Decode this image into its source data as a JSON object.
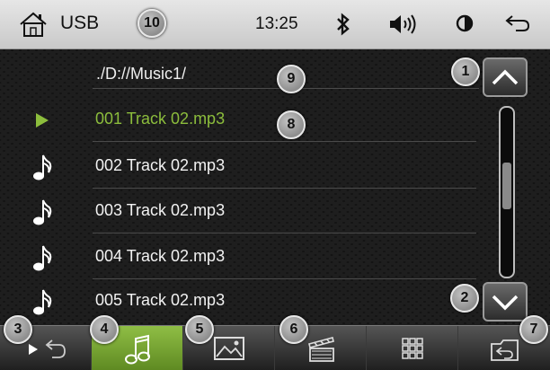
{
  "statusbar": {
    "source": "USB",
    "time": "13:25",
    "icons": [
      "home-icon",
      "bluetooth-icon",
      "volume-icon",
      "brightness-icon",
      "back-icon"
    ]
  },
  "browser": {
    "path": "./D://Music1/",
    "tracks": [
      {
        "name": "001 Track 02.mp3",
        "icon": "play-icon",
        "active": true
      },
      {
        "name": "002 Track 02.mp3",
        "icon": "music-note-icon",
        "active": false
      },
      {
        "name": "003 Track 02.mp3",
        "icon": "music-note-icon",
        "active": false
      },
      {
        "name": "004 Track 02.mp3",
        "icon": "music-note-icon",
        "active": false
      },
      {
        "name": "005 Track 02.mp3",
        "icon": "music-note-icon",
        "active": false
      }
    ],
    "scroll_position": 0.45
  },
  "toolbar": {
    "buttons": [
      {
        "name": "play-return-button",
        "icon": "play-return-icon",
        "active": false
      },
      {
        "name": "music-button",
        "icon": "music-note-icon",
        "active": true
      },
      {
        "name": "picture-button",
        "icon": "picture-icon",
        "active": false
      },
      {
        "name": "video-button",
        "icon": "clapperboard-icon",
        "active": false
      },
      {
        "name": "grid-button",
        "icon": "grid-icon",
        "active": false
      },
      {
        "name": "folder-return-button",
        "icon": "folder-return-icon",
        "active": false
      }
    ]
  },
  "callouts": [
    "1",
    "2",
    "3",
    "4",
    "5",
    "6",
    "7",
    "8",
    "9",
    "10"
  ],
  "colors": {
    "accent_green": "#8cbd3c",
    "status_bar": "#d8d8d8",
    "background": "#111111"
  }
}
